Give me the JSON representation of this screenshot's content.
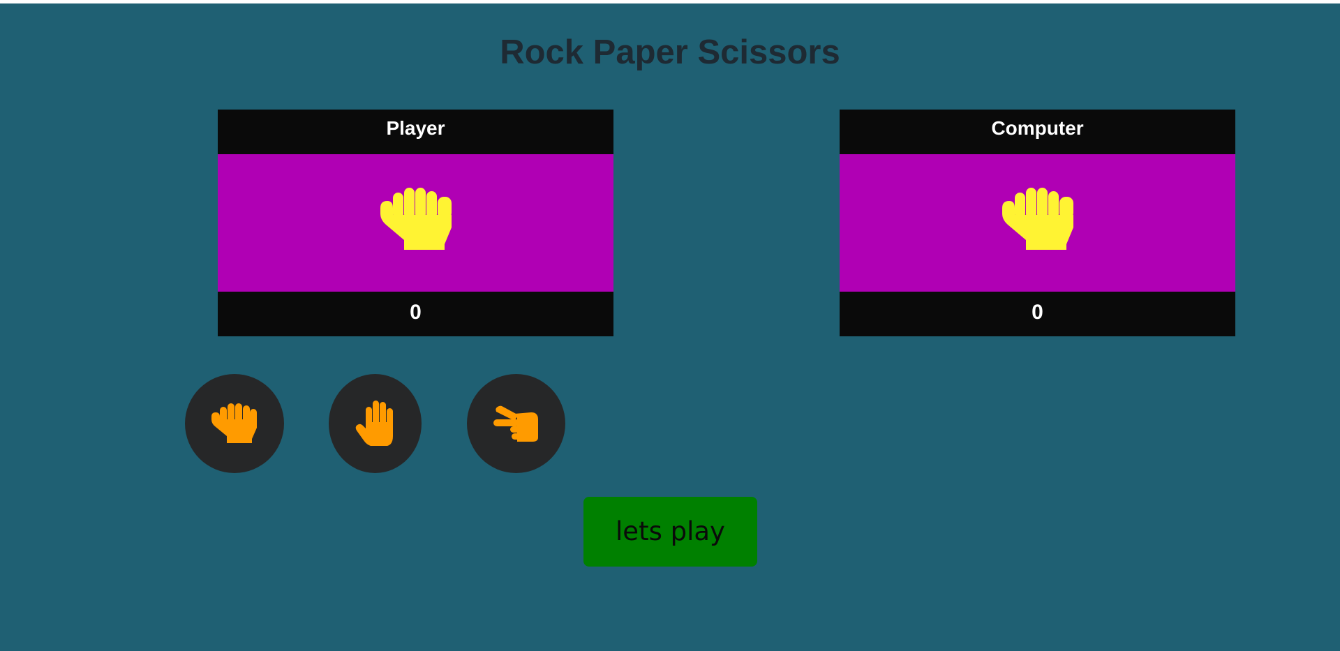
{
  "title": "Rock Paper Scissors",
  "player": {
    "label": "Player",
    "score": "0",
    "hand_icon": "fist-icon"
  },
  "computer": {
    "label": "Computer",
    "score": "0",
    "hand_icon": "fist-icon"
  },
  "choices": [
    {
      "name": "rock",
      "icon": "hand-rock-icon"
    },
    {
      "name": "paper",
      "icon": "hand-paper-icon"
    },
    {
      "name": "scissors",
      "icon": "hand-scissors-icon"
    }
  ],
  "play_button": {
    "label": "lets play"
  },
  "colors": {
    "background": "#1f6073",
    "title": "#1e2a33",
    "card_bar": "#0a0a0a",
    "card_body": "#b000b4",
    "display_hand": "#fff333",
    "choice_bg": "#262728",
    "choice_icon": "#ff9b00",
    "play_button": "#008000"
  }
}
